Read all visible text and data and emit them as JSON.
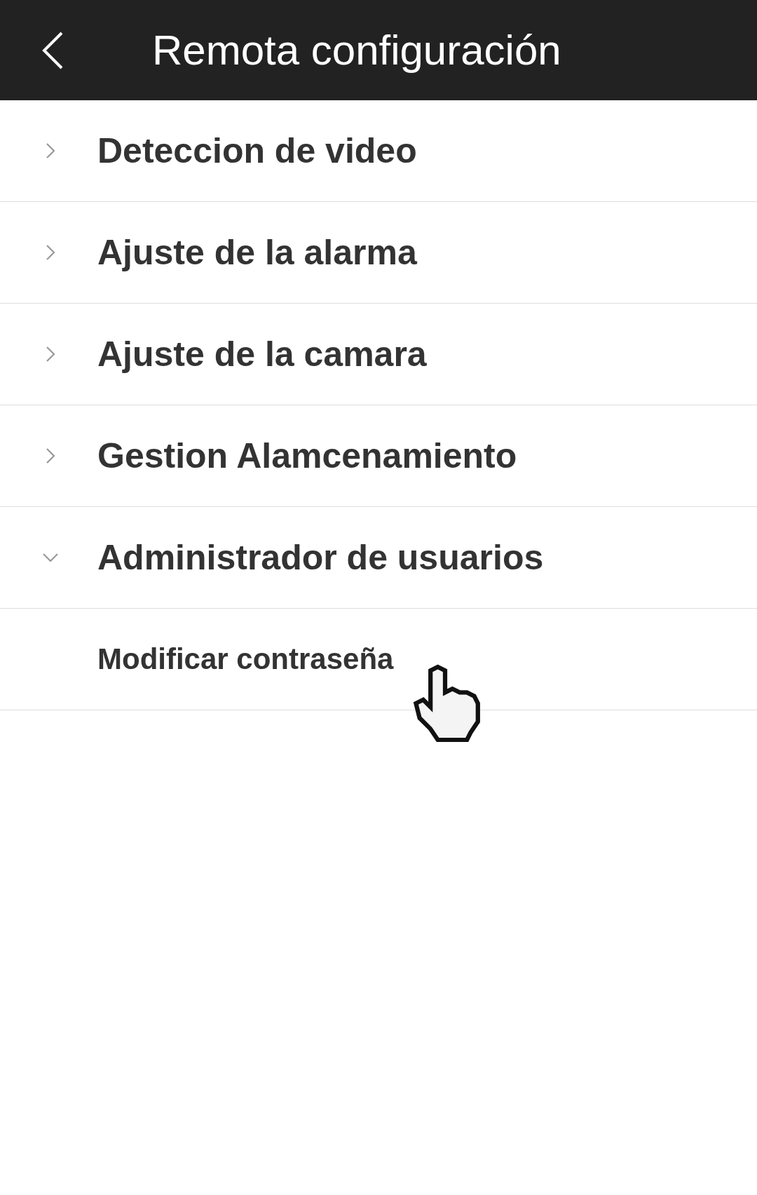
{
  "header": {
    "title": "Remota configuración"
  },
  "menu": [
    {
      "label": "Deteccion de video",
      "expanded": false
    },
    {
      "label": "Ajuste de la alarma",
      "expanded": false
    },
    {
      "label": "Ajuste de la camara",
      "expanded": false
    },
    {
      "label": "Gestion Alamcenamiento",
      "expanded": false
    },
    {
      "label": "Administrador de usuarios",
      "expanded": true,
      "children": [
        {
          "label": "Modificar contraseña"
        }
      ]
    }
  ]
}
